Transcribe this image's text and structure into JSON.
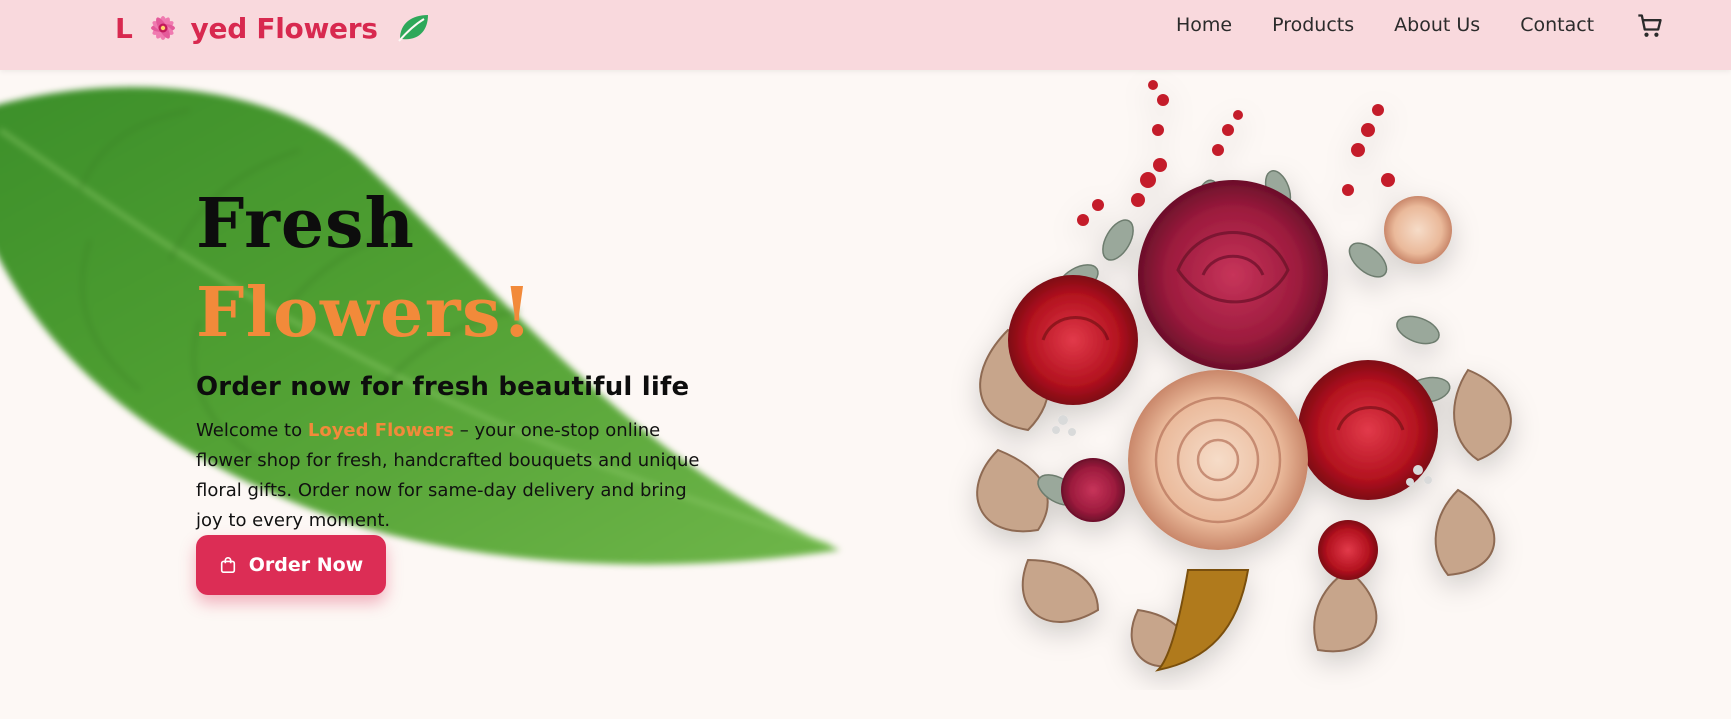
{
  "nav": {
    "brand_prefix": "L",
    "brand_suffix": "yed Flowers",
    "links": [
      "Home",
      "Products",
      "About Us",
      "Contact"
    ],
    "cart_icon": "shopping-cart-icon"
  },
  "hero": {
    "title_line1": "Fresh",
    "title_line2": "Flowers!",
    "subtitle": "Order now for fresh beautiful life",
    "description_before": "Welcome to ",
    "description_brand": "Loyed Flowers",
    "description_after": " – your one-stop online flower shop for fresh, handcrafted bouquets and unique floral gifts. Order now for same-day delivery and bring joy to every moment.",
    "cta_label": "Order Now",
    "cta_icon": "shopping-bag-icon"
  },
  "colors": {
    "accent": "#dc2d55",
    "highlight": "#f28a3a",
    "nav_bg": "#f9d9dd",
    "page_bg": "#fdf8f5"
  }
}
